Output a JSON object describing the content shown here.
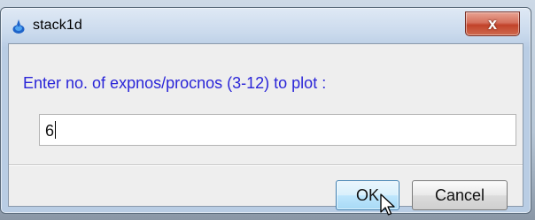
{
  "window": {
    "title": "stack1d",
    "close_glyph": "x"
  },
  "dialog": {
    "prompt": "Enter no. of expnos/procnos (3-12) to plot :",
    "input_value": "6"
  },
  "buttons": {
    "ok_label": "OK",
    "cancel_label": "Cancel"
  },
  "icons": {
    "app": "topspin-app-icon",
    "close": "close-icon",
    "pointer": "mouse-pointer-icon"
  },
  "colors": {
    "prompt_text": "#2a25d8",
    "close_button": "#c2432a",
    "ok_button_focus": "#3c7fb1"
  }
}
